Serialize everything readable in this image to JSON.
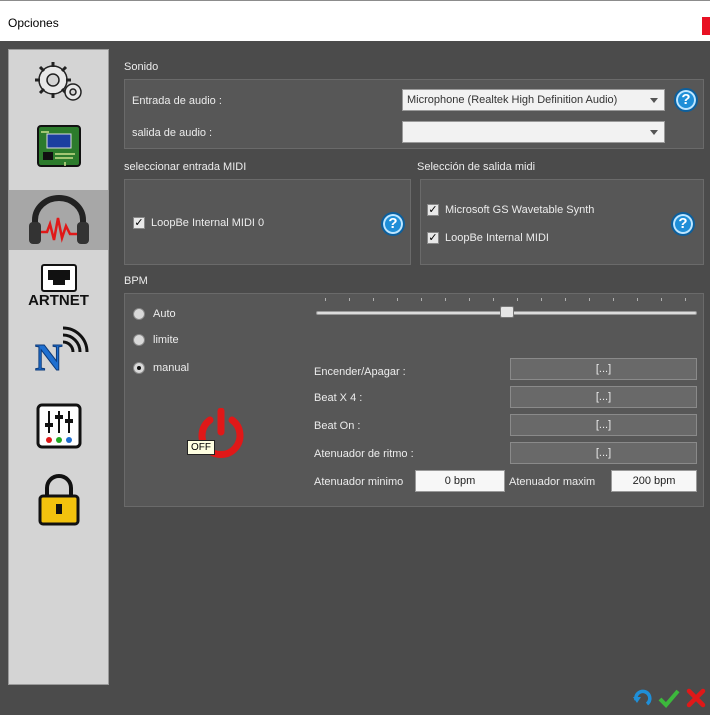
{
  "window": {
    "title": "Opciones"
  },
  "sidebar": {
    "items": [
      {
        "name": "settings",
        "icon": "gears-icon"
      },
      {
        "name": "hardware",
        "icon": "circuit-board-icon"
      },
      {
        "name": "audio",
        "icon": "headphones-icon"
      },
      {
        "name": "artnet",
        "icon": "network-port-icon",
        "label": "ARTNET"
      },
      {
        "name": "wireless",
        "icon": "wifi-n-icon"
      },
      {
        "name": "mixer",
        "icon": "mixer-sliders-icon"
      },
      {
        "name": "lock",
        "icon": "padlock-icon"
      }
    ]
  },
  "sound": {
    "section_label": "Sonido",
    "input_label": "Entrada de audio :",
    "input_value": "Microphone (Realtek High Definition Audio)",
    "output_label": "salida de audio :",
    "output_value": ""
  },
  "midi_in": {
    "section_label": "seleccionar entrada MIDI",
    "items": [
      {
        "label": "LoopBe Internal MIDI 0",
        "checked": true
      }
    ]
  },
  "midi_out": {
    "section_label": "Selección de salida midi",
    "items": [
      {
        "label": "Microsoft GS Wavetable Synth",
        "checked": true
      },
      {
        "label": "LoopBe Internal MIDI",
        "checked": true
      }
    ]
  },
  "bpm": {
    "section_label": "BPM",
    "modes": [
      {
        "label": "Auto",
        "selected": false
      },
      {
        "label": "limite",
        "selected": false
      },
      {
        "label": "manual",
        "selected": true
      }
    ],
    "slider_fraction": 0.5,
    "rows": [
      {
        "label": "Encender/Apagar :",
        "button": "[...]"
      },
      {
        "label": "Beat X 4 :",
        "button": "[...]"
      },
      {
        "label": "Beat On :",
        "button": "[...]"
      },
      {
        "label": "Atenuador de ritmo :",
        "button": "[...]"
      }
    ],
    "min_label": "Atenuador minimo",
    "min_value": "0  bpm",
    "max_label": "Atenuador maxim",
    "max_value": "200 bpm",
    "power_state": "OFF"
  },
  "check_mark": "✓",
  "help_glyph": "?",
  "colors": {
    "accent_help": "#1f8fd8",
    "power_red": "#e01818"
  }
}
